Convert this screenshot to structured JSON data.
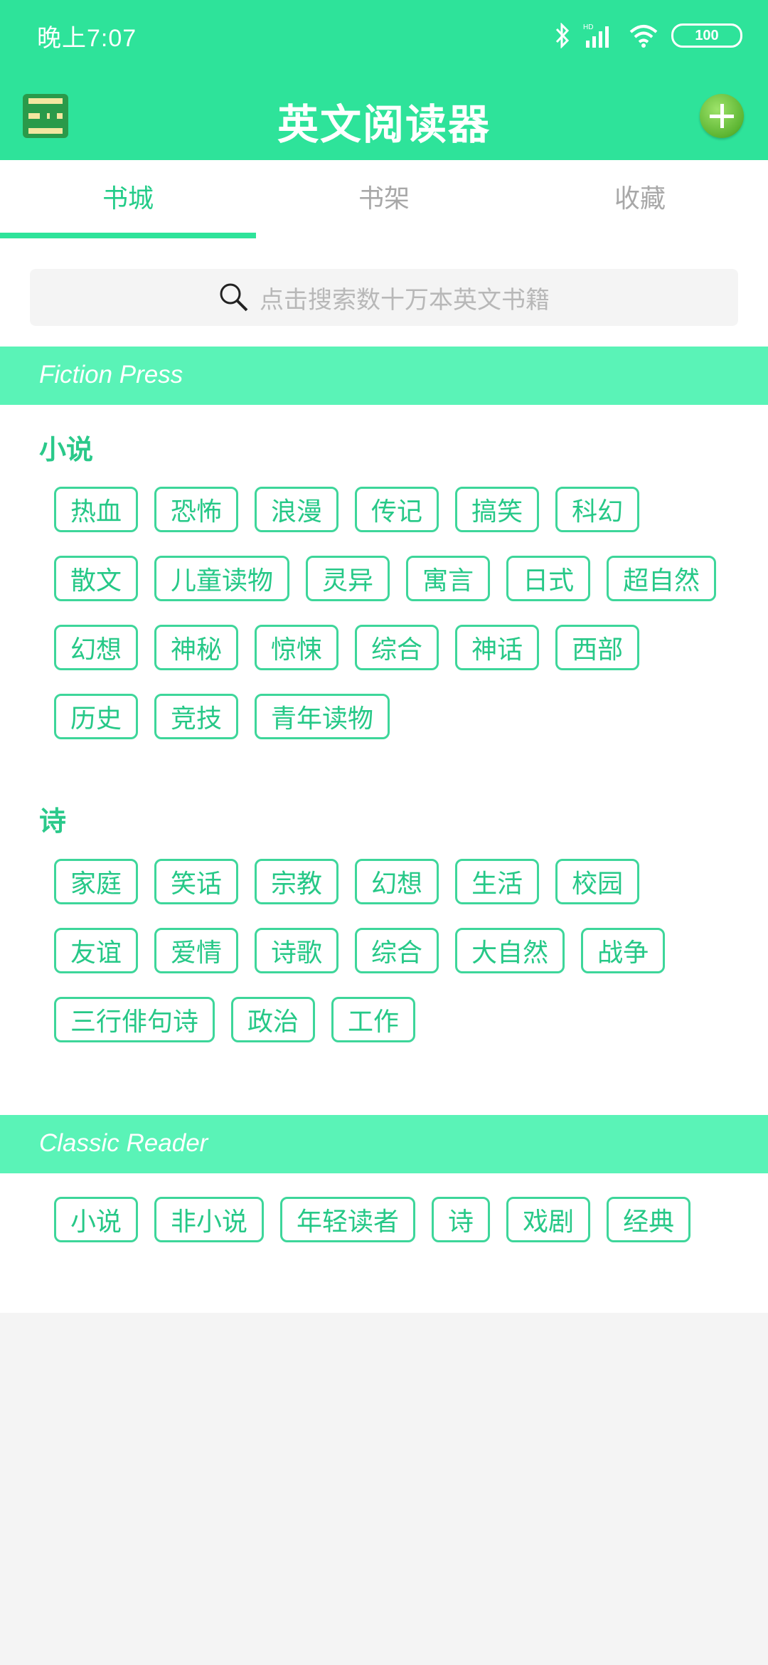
{
  "status_bar": {
    "time": "晚上7:07",
    "battery": "100"
  },
  "app": {
    "title": "英文阅读器"
  },
  "tabs": [
    {
      "label": "书城",
      "active": true
    },
    {
      "label": "书架",
      "active": false
    },
    {
      "label": "收藏",
      "active": false
    }
  ],
  "search": {
    "placeholder": "点击搜索数十万本英文书籍"
  },
  "fiction_press": {
    "title": "Fiction Press",
    "categories": [
      {
        "title": "小说",
        "tags": [
          "热血",
          "恐怖",
          "浪漫",
          "传记",
          "搞笑",
          "科幻",
          "散文",
          "儿童读物",
          "灵异",
          "寓言",
          "日式",
          "超自然",
          "幻想",
          "神秘",
          "惊悚",
          "综合",
          "神话",
          "西部",
          "历史",
          "竞技",
          "青年读物"
        ]
      },
      {
        "title": "诗",
        "tags": [
          "家庭",
          "笑话",
          "宗教",
          "幻想",
          "生活",
          "校园",
          "友谊",
          "爱情",
          "诗歌",
          "综合",
          "大自然",
          "战争",
          "三行俳句诗",
          "政治",
          "工作"
        ]
      }
    ]
  },
  "classic_reader": {
    "title": "Classic Reader",
    "tags": [
      "小说",
      "非小说",
      "年轻读者",
      "诗",
      "戏剧",
      "经典"
    ]
  },
  "colors": {
    "accent": "#2ee39a",
    "section": "#5af3b7",
    "tag_text": "#26c887"
  }
}
